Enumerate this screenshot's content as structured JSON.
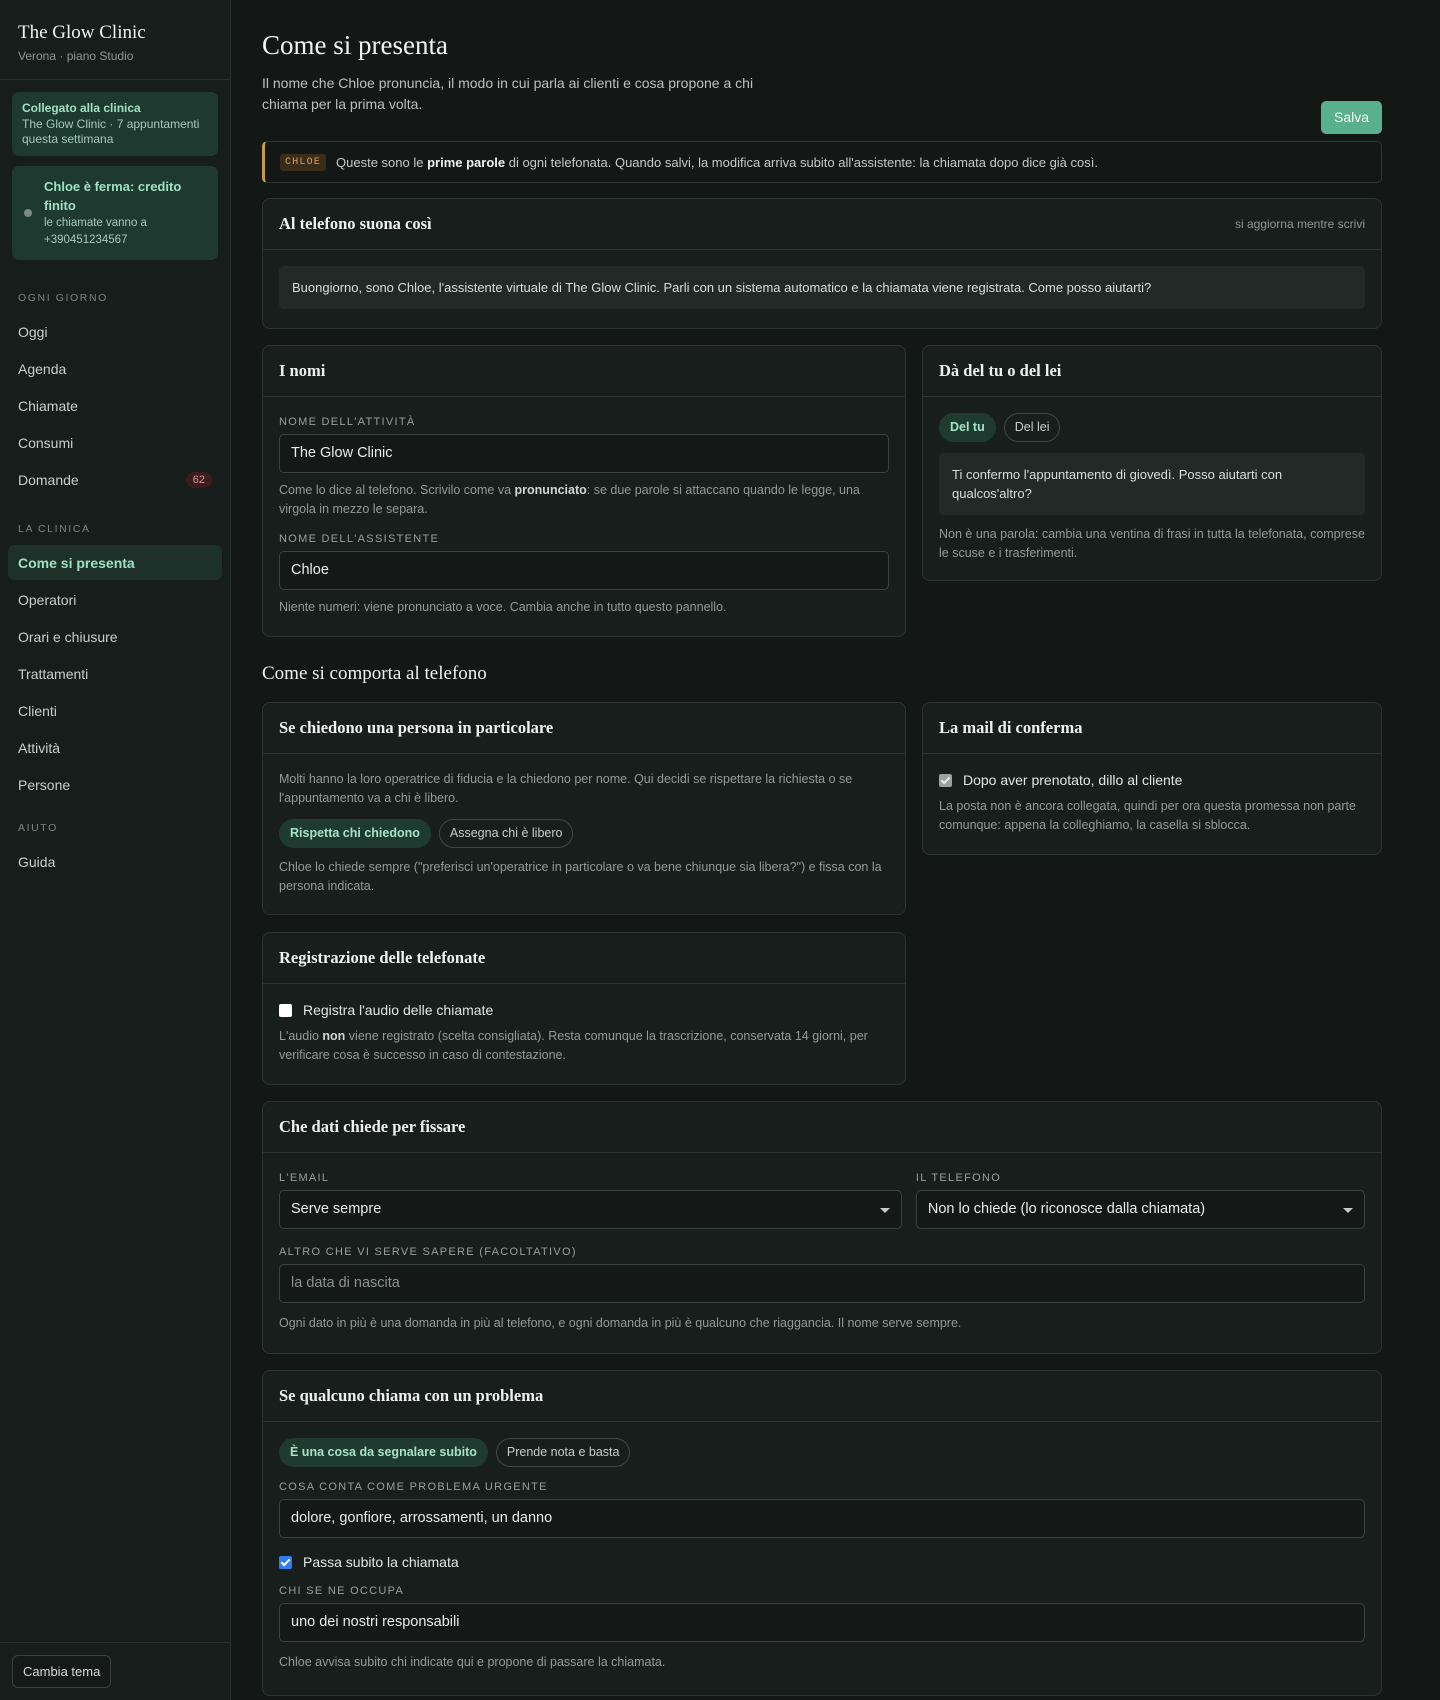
{
  "sidebar": {
    "brand_title": "The Glow Clinic",
    "brand_sub": "Verona · piano Studio",
    "connected_title": "Collegato alla clinica",
    "connected_text": "The Glow Clinic · 7 appuntamenti questa settimana",
    "paused_title": "Chloe è ferma: credito finito",
    "paused_text": "le chiamate vanno a +390451234567",
    "sections": [
      {
        "label": "Ogni giorno",
        "items": [
          {
            "label": "Oggi"
          },
          {
            "label": "Agenda"
          },
          {
            "label": "Chiamate"
          },
          {
            "label": "Consumi"
          },
          {
            "label": "Domande",
            "badge": "62"
          }
        ]
      },
      {
        "label": "La clinica",
        "items": [
          {
            "label": "Come si presenta",
            "active": true
          },
          {
            "label": "Operatori"
          },
          {
            "label": "Orari e chiusure"
          },
          {
            "label": "Trattamenti"
          },
          {
            "label": "Clienti"
          },
          {
            "label": "Attività"
          },
          {
            "label": "Persone"
          }
        ]
      },
      {
        "label": "Aiuto",
        "items": [
          {
            "label": "Guida"
          }
        ]
      }
    ],
    "theme_button": "Cambia tema"
  },
  "header": {
    "title": "Come si presenta",
    "description": "Il nome che Chloe pronuncia, il modo in cui parla ai clienti e cosa propone a chi chiama per la prima volta.",
    "save_label": "Salva"
  },
  "notice": {
    "tag": "CHLOE",
    "text_before": "Queste sono le ",
    "text_bold": "prime parole",
    "text_after": " di ogni telefonata. Quando salvi, la modifica arriva subito all'assistente: la chiamata dopo dice già così."
  },
  "preview": {
    "title": "Al telefono suona così",
    "hint": "si aggiorna mentre scrivi",
    "text": "Buongiorno, sono Chloe, l'assistente virtuale di The Glow Clinic. Parli con un sistema automatico e la chiamata viene registrata. Come posso aiutarti?"
  },
  "names": {
    "title": "I nomi",
    "business_label": "Nome dell'attività",
    "business_value": "The Glow Clinic",
    "business_help_before": "Come lo dice al telefono. Scrivilo come va ",
    "business_help_bold": "pronunciato",
    "business_help_after": ": se due parole si attaccano quando le legge, una virgola in mezzo le separa.",
    "assistant_label": "Nome dell'assistente",
    "assistant_value": "Chloe",
    "assistant_help": "Niente numeri: viene pronunciato a voce. Cambia anche in tutto questo pannello."
  },
  "formality": {
    "title": "Dà del tu o del lei",
    "options": [
      "Del tu",
      "Del lei"
    ],
    "selected": "Del tu",
    "example": "Ti confermo l'appuntamento di giovedì. Posso aiutarti con qualcos'altro?",
    "help": "Non è una parola: cambia una ventina di frasi in tutta la telefonata, comprese le scuse e i trasferimenti."
  },
  "behavior_section_title": "Come si comporta al telefono",
  "specific_person": {
    "title": "Se chiedono una persona in particolare",
    "intro": "Molti hanno la loro operatrice di fiducia e la chiedono per nome. Qui decidi se rispettare la richiesta o se l'appuntamento va a chi è libero.",
    "options": [
      "Rispetta chi chiedono",
      "Assegna chi è libero"
    ],
    "selected": "Rispetta chi chiedono",
    "help": "Chloe lo chiede sempre (\"preferisci un'operatrice in particolare o va bene chiunque sia libera?\") e fissa con la persona indicata."
  },
  "confirmation_mail": {
    "title": "La mail di conferma",
    "checkbox_label": "Dopo aver prenotato, dillo al cliente",
    "checked": true,
    "disabled": true,
    "help": "La posta non è ancora collegata, quindi per ora questa promessa non parte comunque: appena la colleghiamo, la casella si sblocca."
  },
  "recording": {
    "title": "Registrazione delle telefonate",
    "checkbox_label": "Registra l'audio delle chiamate",
    "checked": false,
    "help_before": "L'audio ",
    "help_bold": "non",
    "help_after": " viene registrato (scelta consigliata). Resta comunque la trascrizione, conservata 14 giorni, per verificare cosa è successo in caso di contestazione."
  },
  "booking_data": {
    "title": "Che dati chiede per fissare",
    "email_label": "L'email",
    "email_value": "Serve sempre",
    "phone_label": "Il telefono",
    "phone_value": "Non lo chiede (lo riconosce dalla chiamata)",
    "extra_label": "Altro che vi serve sapere (facoltativo)",
    "extra_placeholder": "la data di nascita",
    "help": "Ogni dato in più è una domanda in più al telefono, e ogni domanda in più è qualcuno che riaggancia. Il nome serve sempre."
  },
  "problem": {
    "title": "Se qualcuno chiama con un problema",
    "options": [
      "È una cosa da segnalare subito",
      "Prende nota e basta"
    ],
    "selected": "È una cosa da segnalare subito",
    "urgent_label": "Cosa conta come problema urgente",
    "urgent_value": "dolore, gonfiore, arrossamenti, un danno",
    "transfer_label": "Passa subito la chiamata",
    "transfer_checked": true,
    "handler_label": "Chi se ne occupa",
    "handler_value": "uno dei nostri responsabili",
    "help": "Chloe avvisa subito chi indicate qui e propone di passare la chiamata."
  }
}
